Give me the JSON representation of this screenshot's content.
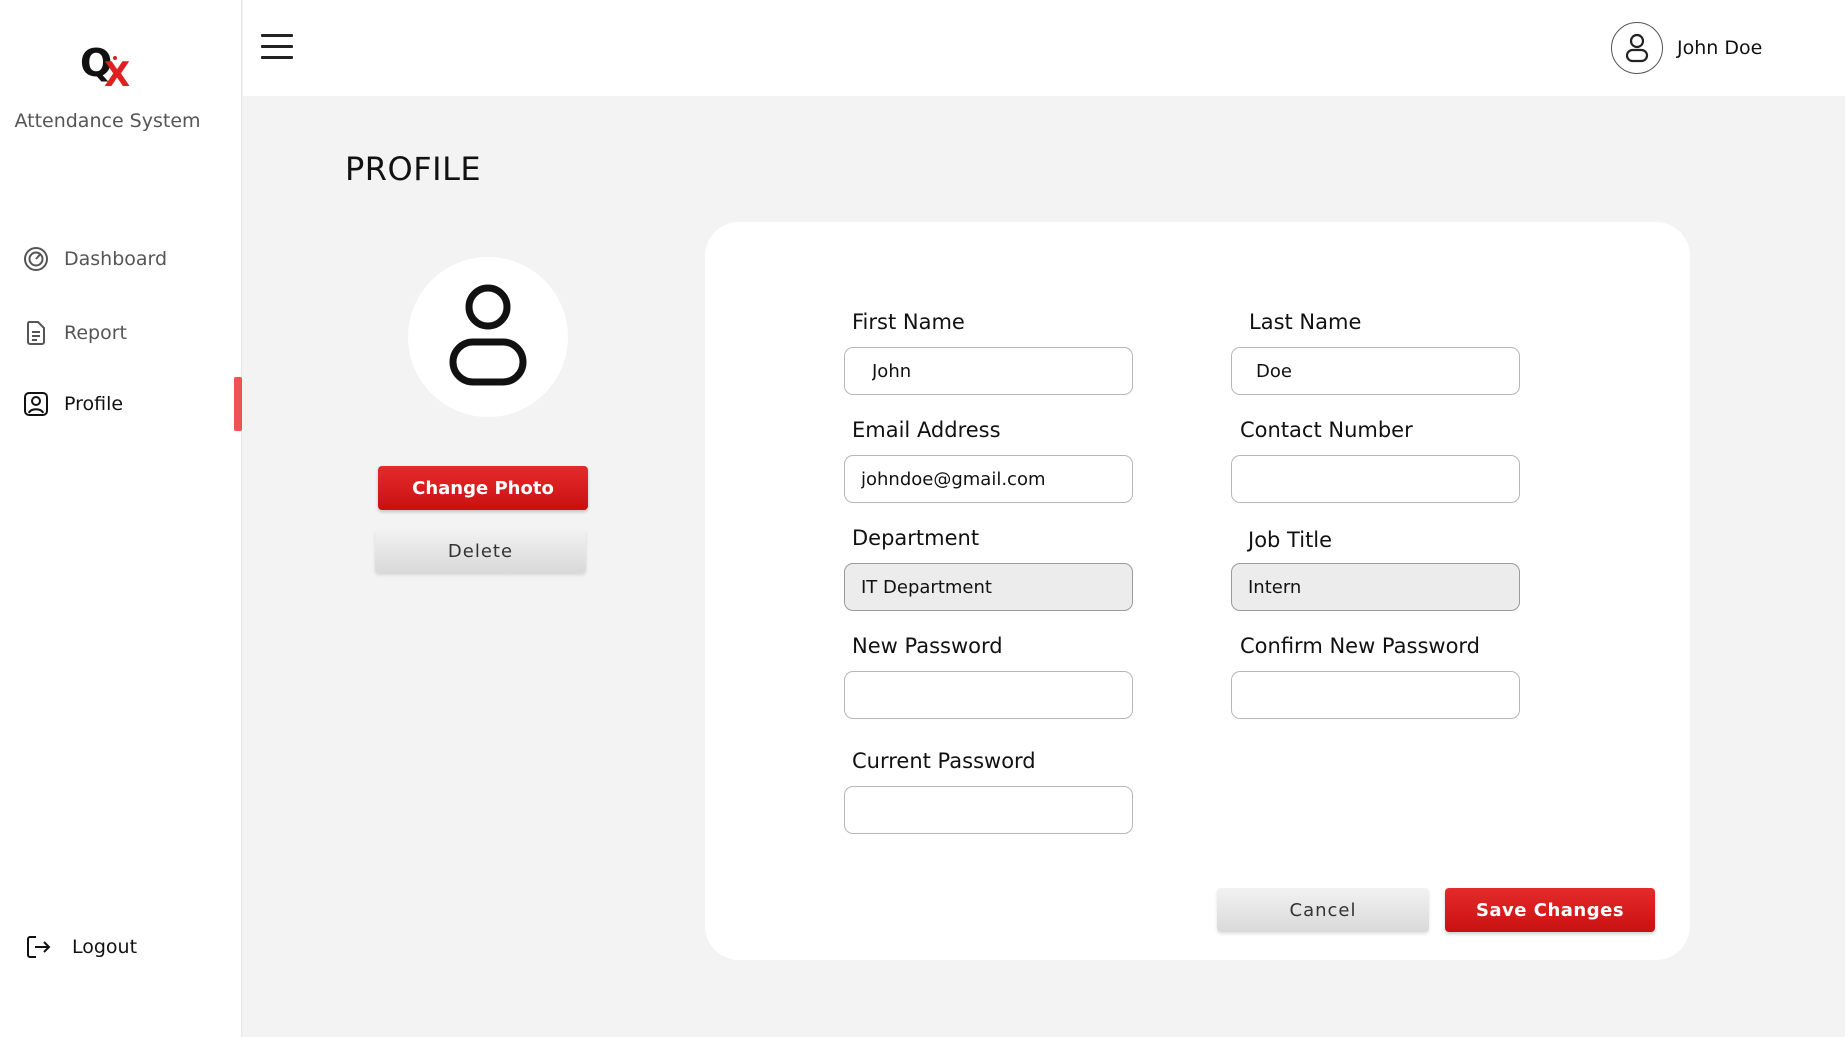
{
  "app": {
    "name": "Attendance System",
    "logo_letters": "QX",
    "accent_color": "#e52a2a"
  },
  "sidebar": {
    "items": [
      {
        "label": "Dashboard",
        "icon": "speedometer-icon"
      },
      {
        "label": "Report",
        "icon": "document-icon"
      },
      {
        "label": "Profile",
        "icon": "user-badge-icon",
        "active": true
      }
    ],
    "logout_label": "Logout"
  },
  "header": {
    "user_name": "John Doe"
  },
  "page": {
    "title": "PROFILE"
  },
  "photo": {
    "change_label": "Change Photo",
    "delete_label": "Delete"
  },
  "form": {
    "first_name": {
      "label": "First Name",
      "value": "John"
    },
    "last_name": {
      "label": "Last Name",
      "value": "Doe"
    },
    "email": {
      "label": "Email Address",
      "value": "johndoe@gmail.com"
    },
    "contact": {
      "label": "Contact Number",
      "value": ""
    },
    "department": {
      "label": "Department",
      "value": "IT Department"
    },
    "job_title": {
      "label": "Job Title",
      "value": "Intern"
    },
    "new_password": {
      "label": "New Password",
      "value": ""
    },
    "confirm_password": {
      "label": "Confirm New Password",
      "value": ""
    },
    "current_password": {
      "label": "Current Password",
      "value": ""
    },
    "cancel_label": "Cancel",
    "save_label": "Save Changes"
  }
}
